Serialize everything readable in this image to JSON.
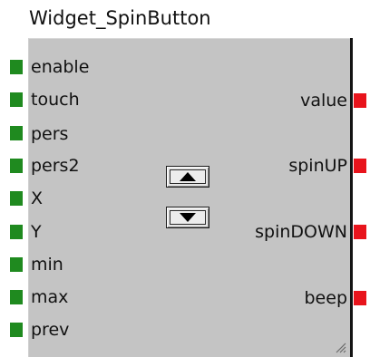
{
  "title": "Widget_SpinButton",
  "colors": {
    "input_port": "#1f8a1f",
    "output_port": "#e8141c",
    "block_fill": "#c4c4c4"
  },
  "inputs": [
    {
      "label": "enable"
    },
    {
      "label": "touch"
    },
    {
      "label": "pers"
    },
    {
      "label": "pers2"
    },
    {
      "label": "X"
    },
    {
      "label": "Y"
    },
    {
      "label": "min"
    },
    {
      "label": "max"
    },
    {
      "label": "prev"
    }
  ],
  "outputs": [
    {
      "label": "value"
    },
    {
      "label": "spinUP"
    },
    {
      "label": "spinDOWN"
    },
    {
      "label": "beep"
    }
  ],
  "spin_buttons": [
    {
      "name": "spin-up-button",
      "icon": "triangle-up-icon"
    },
    {
      "name": "spin-down-button",
      "icon": "triangle-down-icon"
    }
  ],
  "resize_grip_icon": "resize-grip-icon"
}
